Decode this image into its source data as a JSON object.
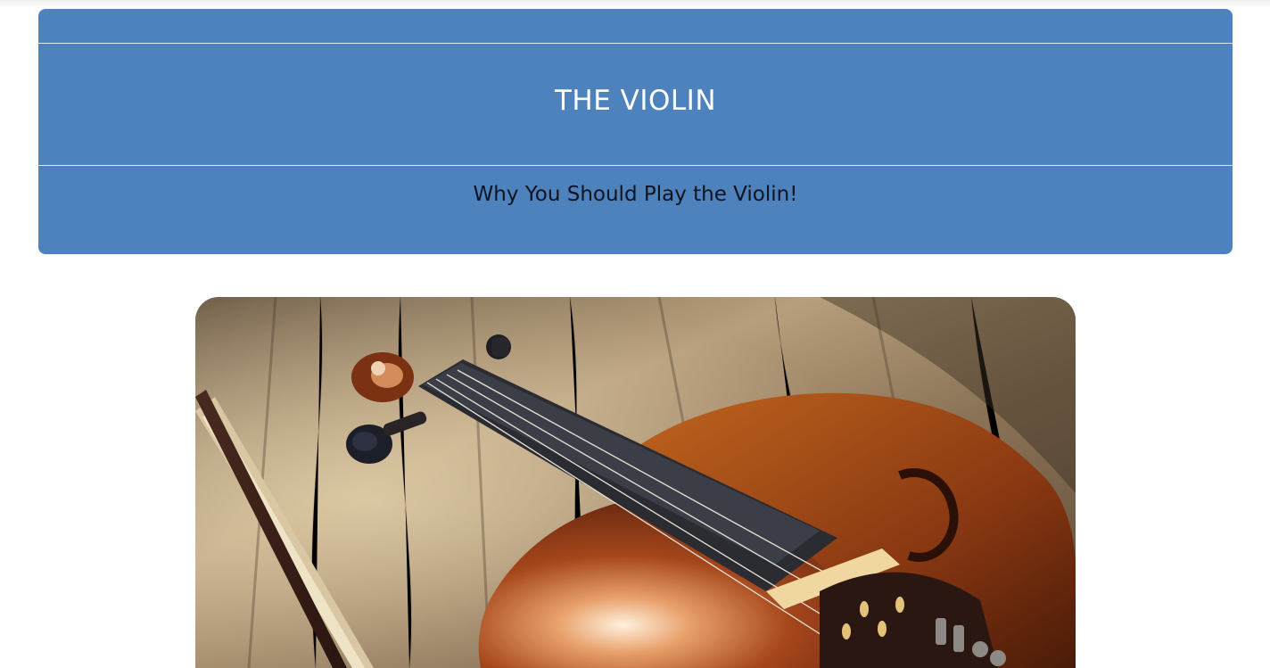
{
  "header": {
    "title": "THE VIOLIN",
    "subtitle": "Why You Should Play the Violin!",
    "background_color": "#4d82bc"
  },
  "hero_image": {
    "subject": "violin and bow resting on a wooden table"
  }
}
